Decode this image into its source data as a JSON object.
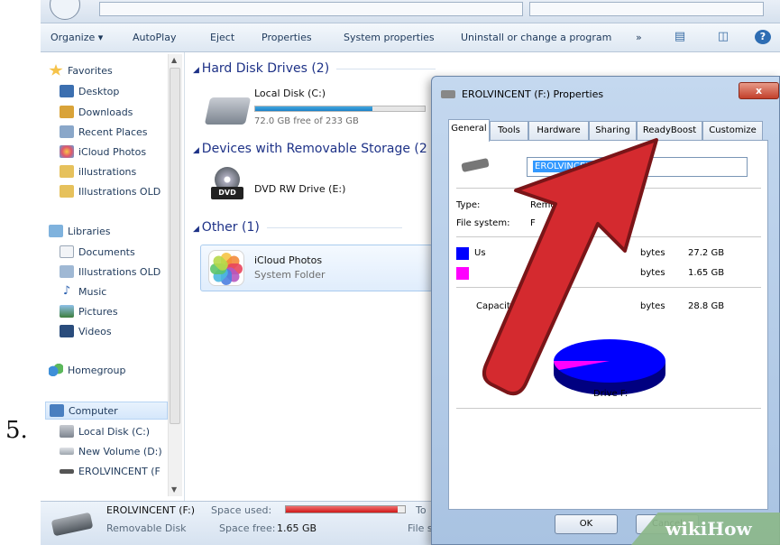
{
  "step_number": "5.",
  "toolbar": {
    "organize": "Organize ▾",
    "autoplay": "AutoPlay",
    "eject": "Eject",
    "properties": "Properties",
    "system_properties": "System properties",
    "uninstall": "Uninstall or change a program",
    "more": "»",
    "help": "?"
  },
  "sidebar": {
    "favorites": "Favorites",
    "fav_items": [
      "Desktop",
      "Downloads",
      "Recent Places",
      "iCloud Photos",
      "illustrations",
      "Illustrations OLD"
    ],
    "libraries": "Libraries",
    "lib_items": [
      "Documents",
      "Illustrations OLD",
      "Music",
      "Pictures",
      "Videos"
    ],
    "homegroup": "Homegroup",
    "computer": "Computer",
    "comp_items": [
      "Local Disk (C:)",
      "New Volume (D:)",
      "EROLVINCENT (F"
    ]
  },
  "main": {
    "group_hdd": "Hard Disk Drives (2)",
    "local_disk_name": "Local Disk (C:)",
    "local_disk_free": "72.0 GB free of 233 GB",
    "local_disk_used_fraction": 0.69,
    "group_removable": "Devices with Removable Storage (2",
    "dvd_name": "DVD RW Drive (E:)",
    "dvd_label": "DVD",
    "group_other": "Other (1)",
    "icloud_name": "iCloud Photos",
    "icloud_sub": "System Folder"
  },
  "status": {
    "drive_name": "EROLVINCENT (F:)",
    "space_used_label": "Space used:",
    "total_label": "To",
    "drive_type": "Removable Disk",
    "space_free_label": "Space free:",
    "space_free_value": "1.65 GB",
    "file_label": "File s",
    "used_fraction": 0.94
  },
  "dialog": {
    "title": "EROLVINCENT (F:) Properties",
    "close": "x",
    "tabs": [
      "General",
      "Tools",
      "Hardware",
      "Sharing",
      "ReadyBoost",
      "Customize"
    ],
    "active_tab": "General",
    "volume_name": "EROLVINCENT",
    "type_label": "Type:",
    "type_value": "Remov",
    "fs_label": "File system:",
    "fs_value": "F",
    "used_label": "Us",
    "used_bytes": "bytes",
    "used_size": "27.2 GB",
    "free_bytes": "bytes",
    "free_size": "1.65 GB",
    "capacity_label": "Capacity:",
    "capacity_bytes": "bytes",
    "capacity_size": "28.8 GB",
    "drive_caption": "Drive F:",
    "ok": "OK",
    "cancel": "Cancel",
    "used_color": "#0000ff",
    "free_color": "#ff00ff"
  },
  "watermark": "wikiHow",
  "accent_arrow_color": "#d42a2f"
}
